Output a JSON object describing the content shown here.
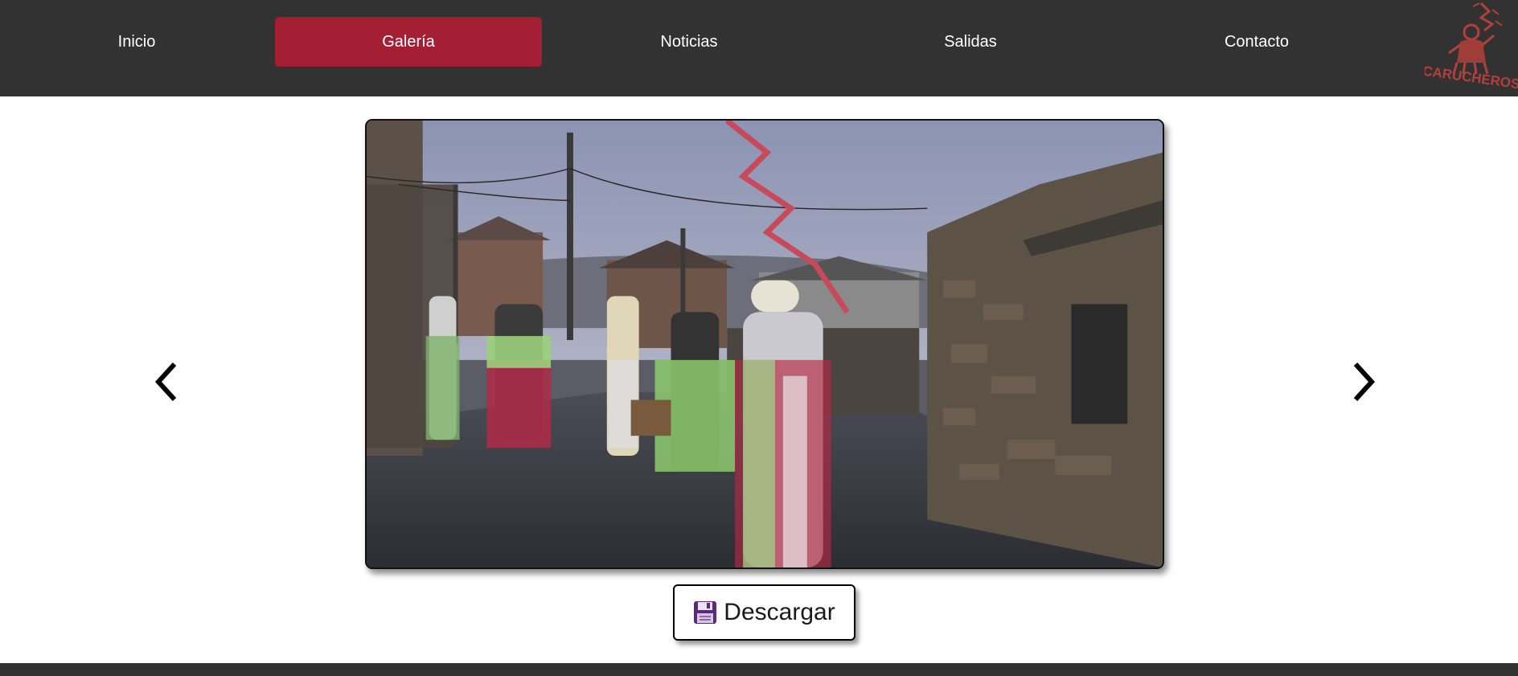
{
  "nav": {
    "items": [
      {
        "label": "Inicio",
        "active": false
      },
      {
        "label": "Galería",
        "active": true
      },
      {
        "label": "Noticias",
        "active": false
      },
      {
        "label": "Salidas",
        "active": false
      },
      {
        "label": "Contacto",
        "active": false
      }
    ],
    "logo_text": "CARUCHEROS"
  },
  "carousel": {
    "prev_icon": "chevron-left-icon",
    "next_icon": "chevron-right-icon"
  },
  "download": {
    "label": "Descargar",
    "icon": "floppy-disk-icon"
  },
  "colors": {
    "header_bg": "#323232",
    "accent": "#a41f33",
    "logo_red": "#c0392b"
  }
}
